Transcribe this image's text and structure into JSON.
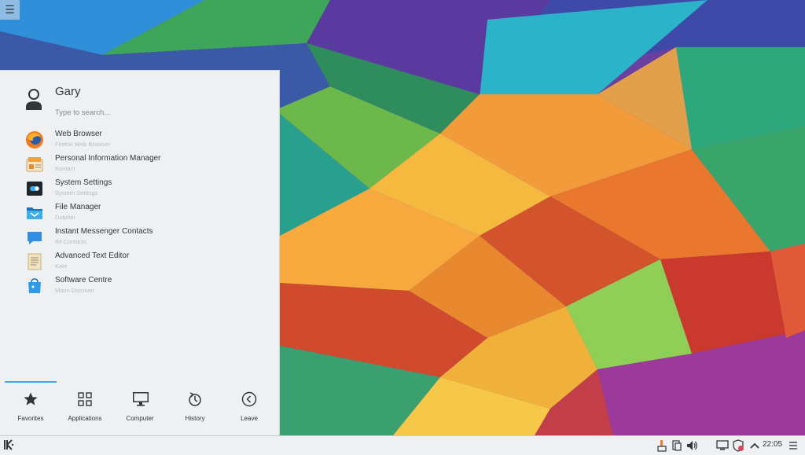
{
  "user": {
    "name": "Gary"
  },
  "search": {
    "placeholder": "Type to search..."
  },
  "favorites": [
    {
      "title": "Web Browser",
      "subtitle": "Firefox Web Browser",
      "icon": "firefox-icon"
    },
    {
      "title": "Personal Information Manager",
      "subtitle": "Kontact",
      "icon": "kontact-icon"
    },
    {
      "title": "System Settings",
      "subtitle": "System Settings",
      "icon": "system-settings-icon"
    },
    {
      "title": "File Manager",
      "subtitle": "Dolphin",
      "icon": "folder-icon"
    },
    {
      "title": "Instant Messenger Contacts",
      "subtitle": "IM Contacts",
      "icon": "chat-icon"
    },
    {
      "title": "Advanced Text Editor",
      "subtitle": "Kate",
      "icon": "text-editor-icon"
    },
    {
      "title": "Software Centre",
      "subtitle": "Muon Discover",
      "icon": "software-centre-icon"
    }
  ],
  "tabs": [
    {
      "label": "Favorites",
      "icon": "star-icon",
      "active": true
    },
    {
      "label": "Applications",
      "icon": "grid-icon",
      "active": false
    },
    {
      "label": "Computer",
      "icon": "monitor-icon",
      "active": false
    },
    {
      "label": "History",
      "icon": "history-icon",
      "active": false
    },
    {
      "label": "Leave",
      "icon": "leave-icon",
      "active": false
    }
  ],
  "taskbar": {
    "clock": "22:05",
    "tray_icons": [
      "notification-icon",
      "clipboard-icon",
      "volume-icon",
      "network-icon",
      "updates-icon",
      "expand-tray-icon",
      "panel-menu-icon"
    ]
  },
  "colors": {
    "accent": "#3daee9",
    "panel_bg": "#eff0f1",
    "text": "#31363b",
    "subtext": "#b8bcc0"
  }
}
